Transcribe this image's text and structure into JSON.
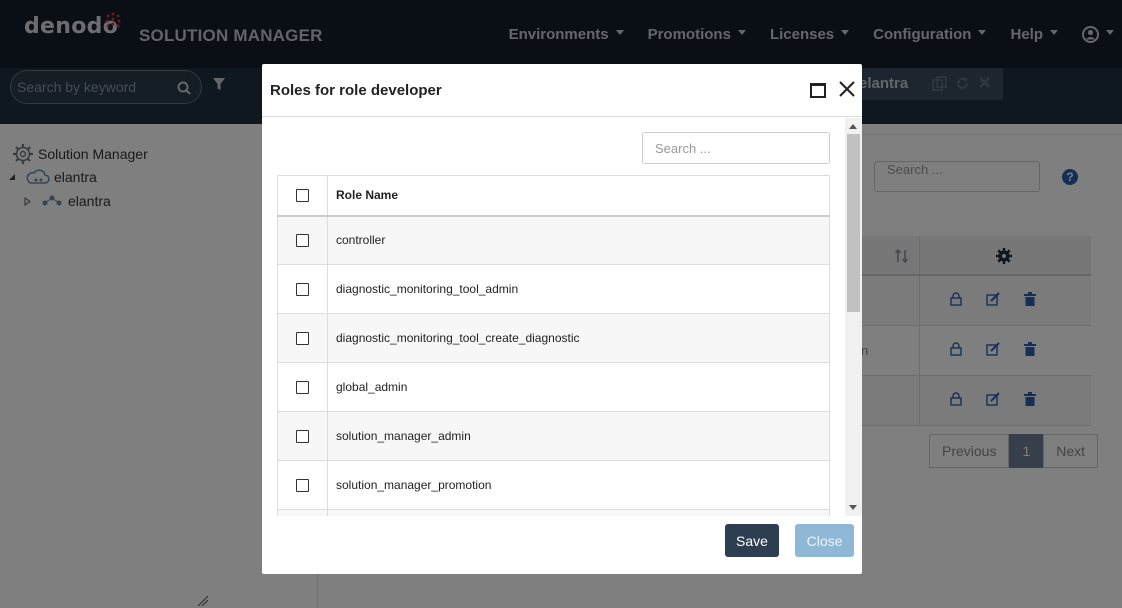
{
  "header": {
    "logo": "denodo",
    "app_name": "SOLUTION MANAGER",
    "nav": [
      "Environments",
      "Promotions",
      "Licenses",
      "Configuration",
      "Help"
    ]
  },
  "toolbar": {
    "search_placeholder": "Search by keyword",
    "env_tab_label": "elantra"
  },
  "tree": {
    "root": "Solution Manager",
    "environment": "elantra",
    "cluster": "elantra"
  },
  "background": {
    "search_placeholder": "Search ...",
    "help": "?",
    "pager": {
      "previous": "Previous",
      "page": "1",
      "next": "Next"
    },
    "partial_cell": "n"
  },
  "modal": {
    "title": "Roles for role developer",
    "search_placeholder": "Search ...",
    "column_header": "Role Name",
    "roles": [
      "controller",
      "diagnostic_monitoring_tool_admin",
      "diagnostic_monitoring_tool_create_diagnostic",
      "global_admin",
      "solution_manager_admin",
      "solution_manager_promotion",
      ""
    ],
    "save_label": "Save",
    "close_label": "Close"
  },
  "colors": {
    "header_bg": "#141f2c",
    "subbar_bg": "#1f2e3e",
    "save_button": "#2c3e50",
    "close_button": "#8fb8d6",
    "icon_blue": "#2a5fb0"
  }
}
